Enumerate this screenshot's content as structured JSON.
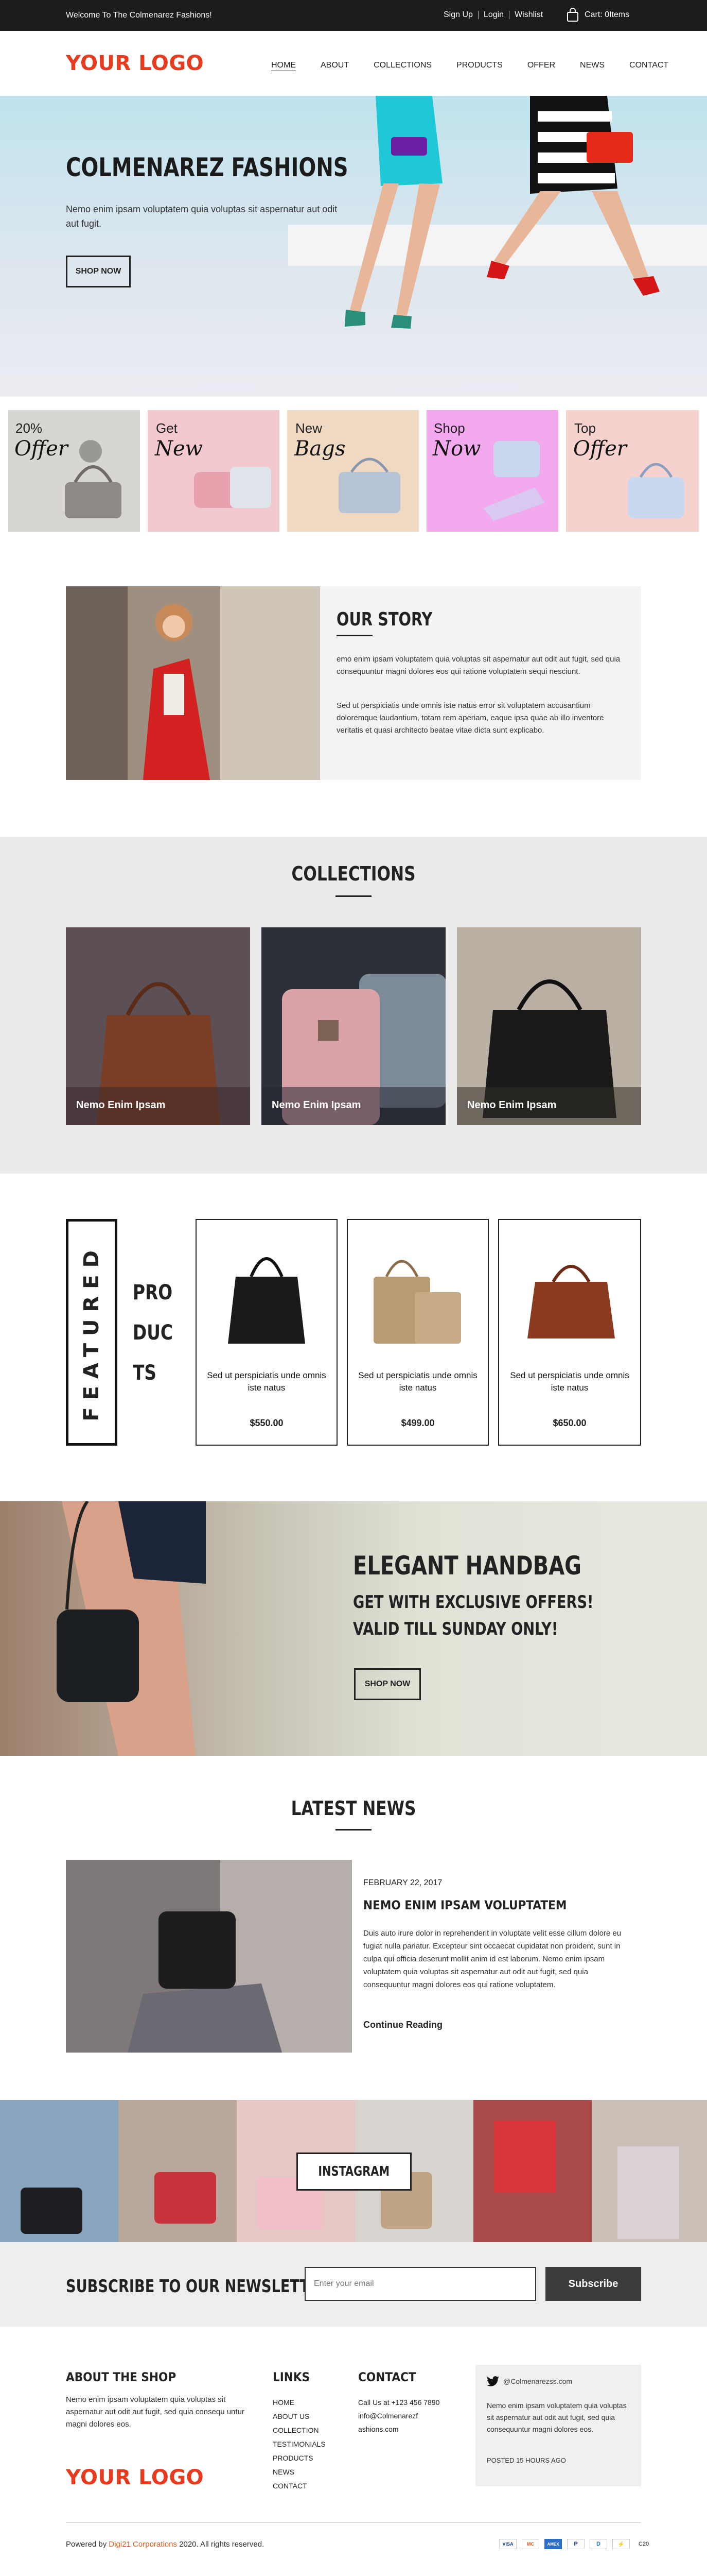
{
  "topbar": {
    "welcome": "Welcome To The Colmenarez Fashions!",
    "links": [
      "Sign Up",
      "Login",
      "Wishlist"
    ],
    "cart": "Cart: 0Items"
  },
  "header": {
    "logo": "YOUR LOGO",
    "nav": [
      "HOME",
      "ABOUT",
      "COLLECTIONS",
      "PRODUCTS",
      "OFFER",
      "NEWS",
      "CONTACT"
    ]
  },
  "hero": {
    "title": "COLMENAREZ FASHIONS",
    "text": "Nemo enim ipsam voluptatem quia voluptas sit aspernatur aut odit aut fugit.",
    "button": "SHOP NOW"
  },
  "promos": [
    {
      "line1": "20%",
      "line2": "Offer",
      "bg": "#d8d6d3"
    },
    {
      "line1": "Get",
      "line2": "New",
      "bg": "#f2c9cf"
    },
    {
      "line1": "New",
      "line2": "Bags",
      "bg": "#f0d9c3"
    },
    {
      "line1": "Shop",
      "line2": "Now",
      "bg": "#f3a9ee"
    },
    {
      "line1": "Top",
      "line2": "Offer",
      "bg": "#f6d2cf"
    }
  ],
  "story": {
    "title": "OUR STORY",
    "p1": "emo enim ipsam voluptatem quia voluptas sit aspernatur aut odit aut fugit, sed quia consequuntur magni dolores eos qui ratione voluptatem sequi nesciunt.",
    "p2": "Sed ut perspiciatis unde omnis iste natus error sit voluptatem accusantium doloremque laudantium, totam rem aperiam, eaque ipsa quae ab illo inventore veritatis et quasi architecto beatae vitae dicta sunt explicabo."
  },
  "collections": {
    "title": "COLLECTIONS",
    "items": [
      "Nemo Enim Ipsam",
      "Nemo Enim Ipsam",
      "Nemo Enim Ipsam"
    ]
  },
  "featured": {
    "vertical": "FEATURED",
    "word": [
      "PRO",
      "DUC",
      "TS"
    ],
    "products": [
      {
        "desc": "Sed ut perspiciatis unde omnis iste natus",
        "price": "$550.00"
      },
      {
        "desc": "Sed ut perspiciatis unde omnis iste natus",
        "price": "$499.00"
      },
      {
        "desc": "Sed ut perspiciatis unde omnis iste natus",
        "price": "$650.00"
      }
    ]
  },
  "offer": {
    "title": "ELEGANT HANDBAG",
    "line1": "GET WITH EXCLUSIVE OFFERS!",
    "line2": "VALID TILL SUNDAY ONLY!",
    "button": "SHOP NOW"
  },
  "news": {
    "title": "LATEST NEWS",
    "date": "FEBRUARY 22, 2017",
    "headline": "NEMO ENIM IPSAM VOLUPTATEM",
    "text": "Duis auto irure dolor in reprehenderit in voluptate velit esse cillum dolore eu fugiat nulla pariatur. Excepteur sint occaecat cupidatat non proident, sunt in culpa qui officia deserunt mollit anim id est laborum. Nemo enim ipsam voluptatem quia voluptas sit aspernatur aut odit aut fugit, sed quia consequuntur magni dolores eos qui ratione voluptatem.",
    "link": "Continue Reading"
  },
  "instagram": {
    "label": "INSTAGRAM"
  },
  "newsletter": {
    "label": "SUBSCRIBE TO OUR NEWSLETTER:",
    "placeholder": "Enter your email",
    "button": "Subscribe"
  },
  "footer": {
    "about_title": "ABOUT THE SHOP",
    "about_text": "Nemo enim ipsam voluptatem quia voluptas sit aspernatur aut odit aut fugit, sed quia consequ untur magni dolores eos.",
    "logo": "YOUR LOGO",
    "links_title": "LINKS",
    "links": [
      "HOME",
      "ABOUT US",
      "COLLECTION",
      "TESTIMONIALS",
      "PRODUCTS",
      "NEWS",
      "CONTACT"
    ],
    "contact_title": "CONTACT",
    "contact": [
      "Call Us at +123 456 7890",
      "info@Colmenarezf",
      "ashions.com"
    ],
    "twitter_handle": "@Colmenarezss.com",
    "tweet": "Nemo enim ipsam voluptatem quia voluptas sit aspernatur aut odit aut fugit, sed quia consequuntur magni dolores eos.",
    "posted": "POSTED 15 HOURS AGO",
    "powered_prefix": "Powered by",
    "powered_brand": "Digi21 Corporations",
    "powered_suffix": "2020. All rights reserved.",
    "payments": [
      "VISA",
      "MC",
      "AMEX",
      "P",
      "D",
      "⚡",
      "C20"
    ]
  },
  "colors": {
    "accent": "#e63b1f",
    "dark": "#1c1c1c",
    "brand_link": "#e65a1f"
  }
}
